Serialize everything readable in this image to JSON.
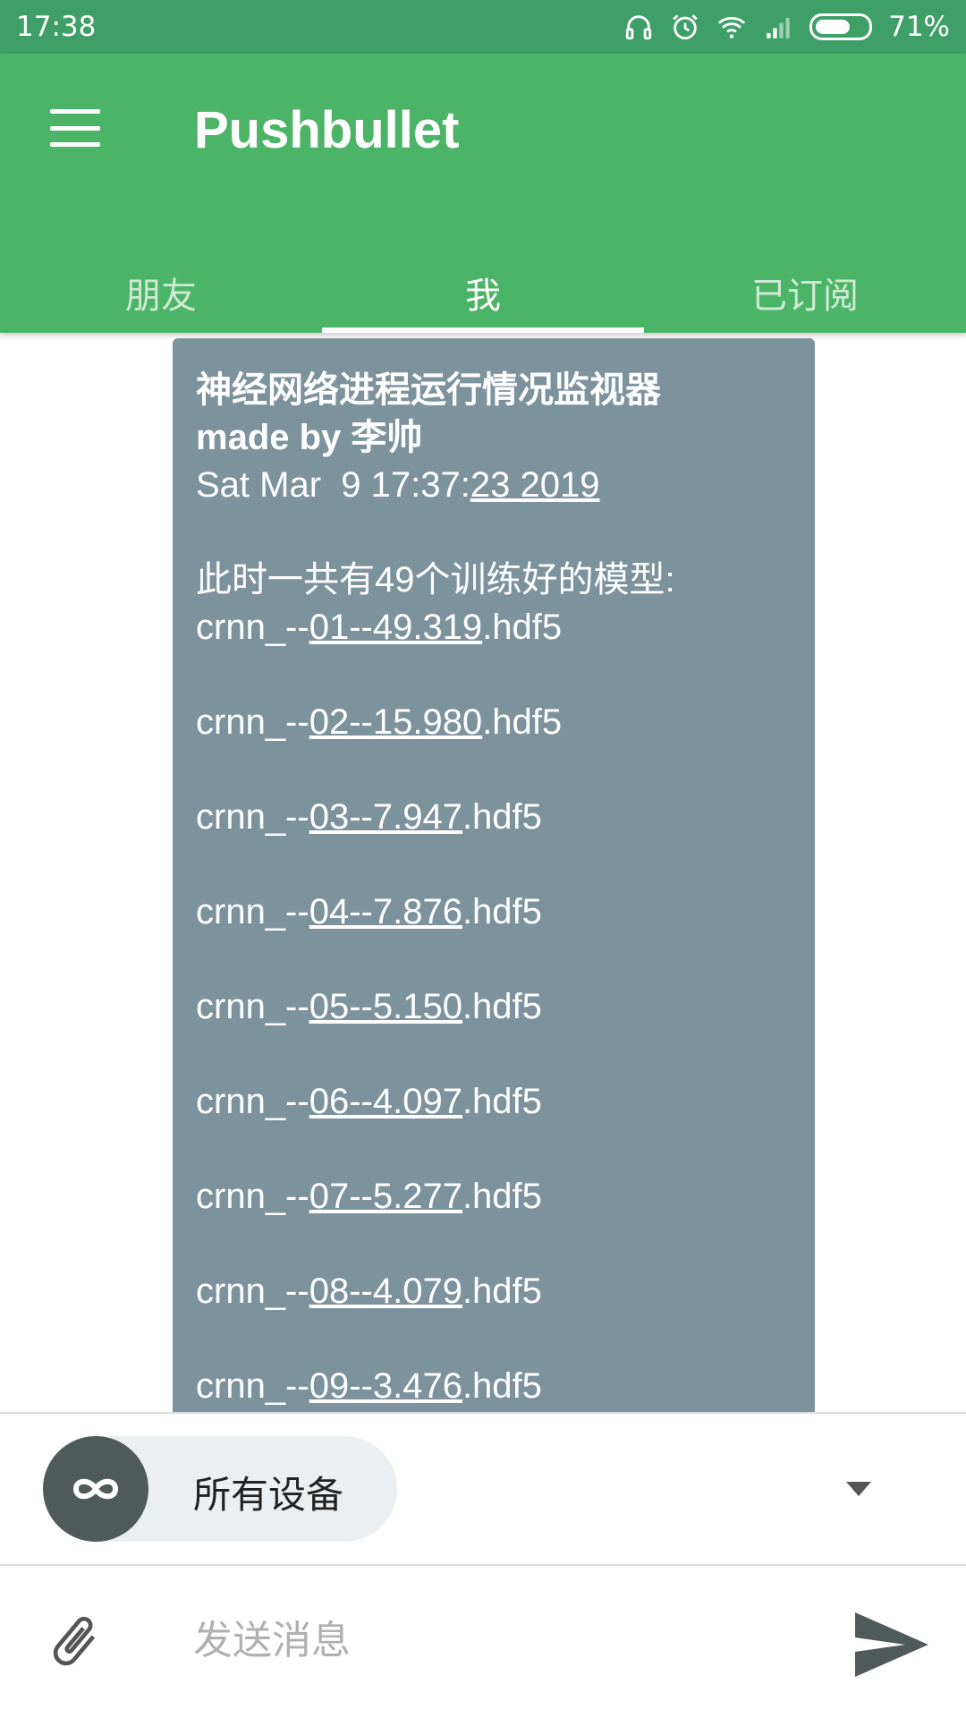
{
  "status_bar": {
    "time": "17:38",
    "battery": "71%",
    "battery_level": 0.71
  },
  "app_bar": {
    "title": "Pushbullet",
    "tabs": [
      {
        "label": "朋友",
        "active": false
      },
      {
        "label": "我",
        "active": true
      },
      {
        "label": "已订阅",
        "active": false
      }
    ]
  },
  "message": {
    "title_line1": "神经网络进程运行情况监视器",
    "title_line2": "made by 李帅",
    "date_prefix": "Sat Mar  9 17:37:",
    "date_link": "23 2019",
    "summary": "此时一共有49个训练好的模型:",
    "files": [
      {
        "prefix": "crnn_--",
        "link": "01--49.319",
        "suffix": ".hdf5"
      },
      {
        "prefix": "crnn_--",
        "link": "02--15.980",
        "suffix": ".hdf5"
      },
      {
        "prefix": "crnn_--",
        "link": "03--7.947",
        "suffix": ".hdf5"
      },
      {
        "prefix": "crnn_--",
        "link": "04--7.876",
        "suffix": ".hdf5"
      },
      {
        "prefix": "crnn_--",
        "link": "05--5.150",
        "suffix": ".hdf5"
      },
      {
        "prefix": "crnn_--",
        "link": "06--4.097",
        "suffix": ".hdf5"
      },
      {
        "prefix": "crnn_--",
        "link": "07--5.277",
        "suffix": ".hdf5"
      },
      {
        "prefix": "crnn_--",
        "link": "08--4.079",
        "suffix": ".hdf5"
      },
      {
        "prefix": "crnn_--",
        "link": "09--3.476",
        "suffix": ".hdf5"
      }
    ]
  },
  "device_selector": {
    "label": "所有设备",
    "icon": "infinity-icon"
  },
  "composer": {
    "placeholder": "发送消息"
  },
  "colors": {
    "status_bar": "#3ea066",
    "app_bar": "#4cb467",
    "message_bubble": "#7c939e",
    "device_avatar": "#4f5b5a"
  }
}
